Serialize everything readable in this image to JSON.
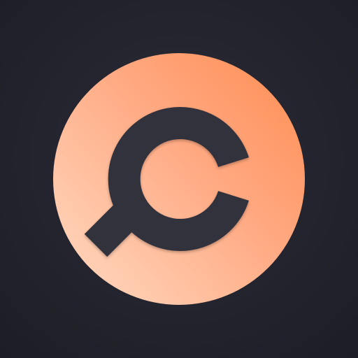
{
  "app_icon": {
    "icon": "search-magnifier-c-logo-icon",
    "colors": {
      "background": "#252530",
      "accent_light": "#ffd4ba",
      "accent_mid": "#ffa982",
      "accent_dark": "#ff8e54",
      "glyph": "#33323e"
    }
  }
}
